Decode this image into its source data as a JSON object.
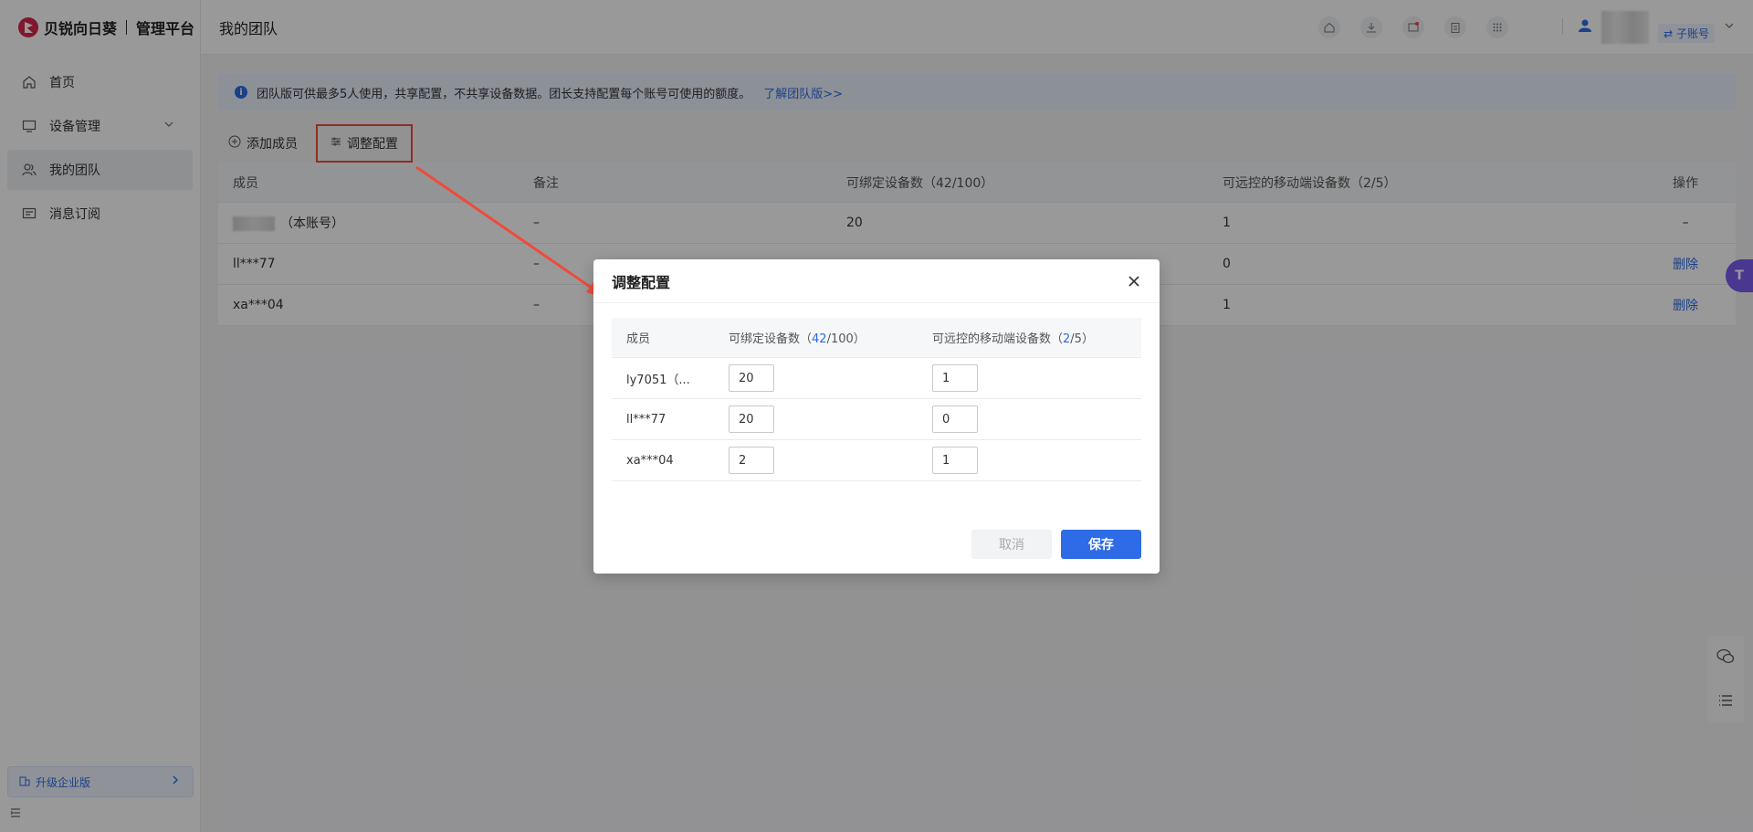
{
  "app": {
    "brand": "贝锐向日葵",
    "subtitle": "管理平台"
  },
  "sidebar": {
    "items": [
      {
        "label": "首页",
        "icon": "home-icon"
      },
      {
        "label": "设备管理",
        "icon": "monitor-icon"
      },
      {
        "label": "我的团队",
        "icon": "team-icon",
        "active": true
      },
      {
        "label": "消息订阅",
        "icon": "message-icon"
      }
    ],
    "upgrade_label": "升级企业版"
  },
  "header": {
    "title": "我的团队",
    "sub_account_label": "⇄ 子账号"
  },
  "info": {
    "text": "团队版可供最多5人使用，共享配置，不共享设备数据。团长支持配置每个账号可使用的额度。",
    "link": "了解团队版>>"
  },
  "actions": {
    "add_member": "添加成员",
    "adjust_config": "调整配置"
  },
  "team_table": {
    "headers": [
      "成员",
      "备注",
      "可绑定设备数（42/100）",
      "可远控的移动端设备数（2/5）",
      "操作"
    ],
    "rows": [
      {
        "member_suffix": "（本账号）",
        "note": "–",
        "bind": "20",
        "mobile": "1",
        "op": "–"
      },
      {
        "member": "ll***77",
        "note": "–",
        "bind": "",
        "mobile": "0",
        "op": "删除"
      },
      {
        "member": "xa***04",
        "note": "–",
        "bind": "",
        "mobile": "1",
        "op": "删除"
      }
    ]
  },
  "modal": {
    "title": "调整配置",
    "headers": {
      "member": "成员",
      "bind_prefix": "可绑定设备数（",
      "bind_used": "42",
      "bind_total": "/100）",
      "mobile_prefix": "可远控的移动端设备数（",
      "mobile_used": "2",
      "mobile_total": "/5）"
    },
    "rows": [
      {
        "member": "ly7051（...",
        "bind": "20",
        "mobile": "1"
      },
      {
        "member": "ll***77",
        "bind": "20",
        "mobile": "0"
      },
      {
        "member": "xa***04",
        "bind": "2",
        "mobile": "1"
      }
    ],
    "cancel_label": "取消",
    "save_label": "保存"
  },
  "colors": {
    "accent": "#2e6be6",
    "annotation": "#ee4b3b",
    "brand": "#d7264f"
  }
}
